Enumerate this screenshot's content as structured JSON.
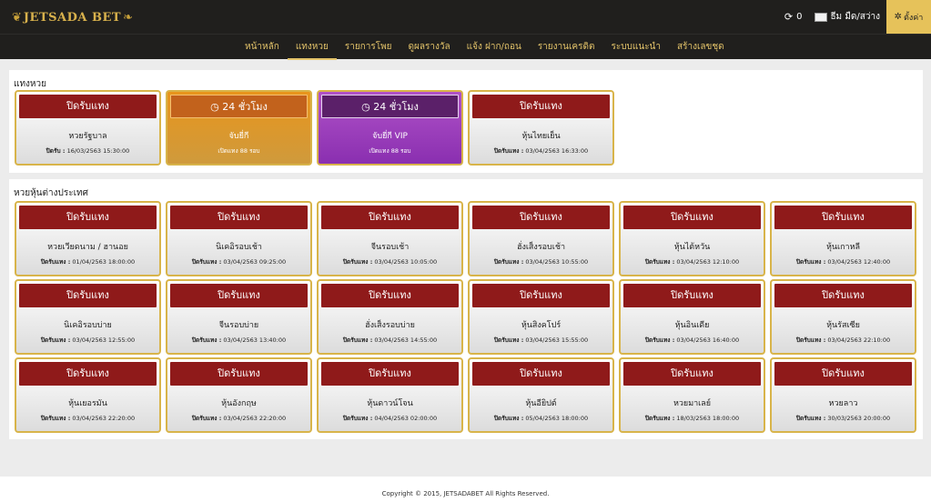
{
  "header": {
    "logo_text": "JETSADA BET",
    "refresh_count": "0",
    "theme_label": "ธีม มืด/สว่าง",
    "settings_label": "ตั้งค่า"
  },
  "nav": [
    {
      "label": "หน้าหลัก",
      "active": false
    },
    {
      "label": "แทงหวย",
      "active": true
    },
    {
      "label": "รายการโพย",
      "active": false
    },
    {
      "label": "ดูผลรางวัล",
      "active": false
    },
    {
      "label": "แจ้ง ฝาก/ถอน",
      "active": false
    },
    {
      "label": "รายงานเครดิต",
      "active": false
    },
    {
      "label": "ระบบแนะนำ",
      "active": false
    },
    {
      "label": "สร้างเลขชุด",
      "active": false
    }
  ],
  "sections": [
    {
      "title": "แทงหวย",
      "cards": [
        {
          "button": "ปิดรับแทง",
          "name": "หวยรัฐบาล",
          "close_label": "ปิดรับ :",
          "close_time": "16/03/2563 15:30:00",
          "style": "closed"
        },
        {
          "button": "24 ชั่วโมง",
          "name": "จับยี่กี",
          "close_label": "",
          "close_time": "เปิดแทง 88 รอบ",
          "style": "orange",
          "icon": "clock-icon"
        },
        {
          "button": "24 ชั่วโมง",
          "name": "จับยี่กี VIP",
          "close_label": "",
          "close_time": "เปิดแทง 88 รอบ",
          "style": "purple",
          "icon": "clock-icon"
        },
        {
          "button": "ปิดรับแทง",
          "name": "หุ้นไทยเย็น",
          "close_label": "ปิดรับแทง :",
          "close_time": "03/04/2563 16:33:00",
          "style": "closed"
        }
      ]
    },
    {
      "title": "หวยหุ้นต่างประเทศ",
      "cards": [
        {
          "button": "ปิดรับแทง",
          "name": "หวยเวียดนาม / ฮานอย",
          "close_label": "ปิดรับแทง :",
          "close_time": "01/04/2563 18:00:00",
          "style": "closed"
        },
        {
          "button": "ปิดรับแทง",
          "name": "นิเคอิรอบเช้า",
          "close_label": "ปิดรับแทง :",
          "close_time": "03/04/2563 09:25:00",
          "style": "closed"
        },
        {
          "button": "ปิดรับแทง",
          "name": "จีนรอบเช้า",
          "close_label": "ปิดรับแทง :",
          "close_time": "03/04/2563 10:05:00",
          "style": "closed"
        },
        {
          "button": "ปิดรับแทง",
          "name": "ฮั่งเส็งรอบเช้า",
          "close_label": "ปิดรับแทง :",
          "close_time": "03/04/2563 10:55:00",
          "style": "closed"
        },
        {
          "button": "ปิดรับแทง",
          "name": "หุ้นไต้หวัน",
          "close_label": "ปิดรับแทง :",
          "close_time": "03/04/2563 12:10:00",
          "style": "closed"
        },
        {
          "button": "ปิดรับแทง",
          "name": "หุ้นเกาหลี",
          "close_label": "ปิดรับแทง :",
          "close_time": "03/04/2563 12:40:00",
          "style": "closed"
        },
        {
          "button": "ปิดรับแทง",
          "name": "นิเคอิรอบบ่าย",
          "close_label": "ปิดรับแทง :",
          "close_time": "03/04/2563 12:55:00",
          "style": "closed"
        },
        {
          "button": "ปิดรับแทง",
          "name": "จีนรอบบ่าย",
          "close_label": "ปิดรับแทง :",
          "close_time": "03/04/2563 13:40:00",
          "style": "closed"
        },
        {
          "button": "ปิดรับแทง",
          "name": "ฮั่งเส็งรอบบ่าย",
          "close_label": "ปิดรับแทง :",
          "close_time": "03/04/2563 14:55:00",
          "style": "closed"
        },
        {
          "button": "ปิดรับแทง",
          "name": "หุ้นสิงคโปร์",
          "close_label": "ปิดรับแทง :",
          "close_time": "03/04/2563 15:55:00",
          "style": "closed"
        },
        {
          "button": "ปิดรับแทง",
          "name": "หุ้นอินเดีย",
          "close_label": "ปิดรับแทง :",
          "close_time": "03/04/2563 16:40:00",
          "style": "closed"
        },
        {
          "button": "ปิดรับแทง",
          "name": "หุ้นรัสเซีย",
          "close_label": "ปิดรับแทง :",
          "close_time": "03/04/2563 22:10:00",
          "style": "closed"
        },
        {
          "button": "ปิดรับแทง",
          "name": "หุ้นเยอรมัน",
          "close_label": "ปิดรับแทง :",
          "close_time": "03/04/2563 22:20:00",
          "style": "closed"
        },
        {
          "button": "ปิดรับแทง",
          "name": "หุ้นอังกฤษ",
          "close_label": "ปิดรับแทง :",
          "close_time": "03/04/2563 22:20:00",
          "style": "closed"
        },
        {
          "button": "ปิดรับแทง",
          "name": "หุ้นดาวน์โจน",
          "close_label": "ปิดรับแทง :",
          "close_time": "04/04/2563 02:00:00",
          "style": "closed"
        },
        {
          "button": "ปิดรับแทง",
          "name": "หุ้นอียิปต์",
          "close_label": "ปิดรับแทง :",
          "close_time": "05/04/2563 18:00:00",
          "style": "closed"
        },
        {
          "button": "ปิดรับแทง",
          "name": "หวยมาเลย์",
          "close_label": "ปิดรับแทง :",
          "close_time": "18/03/2563 18:00:00",
          "style": "closed"
        },
        {
          "button": "ปิดรับแทง",
          "name": "หวยลาว",
          "close_label": "ปิดรับแทง :",
          "close_time": "30/03/2563 20:00:00",
          "style": "closed"
        }
      ]
    }
  ],
  "footer": {
    "copyright": "Copyright © 2015, JETSADABET All Rights Reserved."
  }
}
